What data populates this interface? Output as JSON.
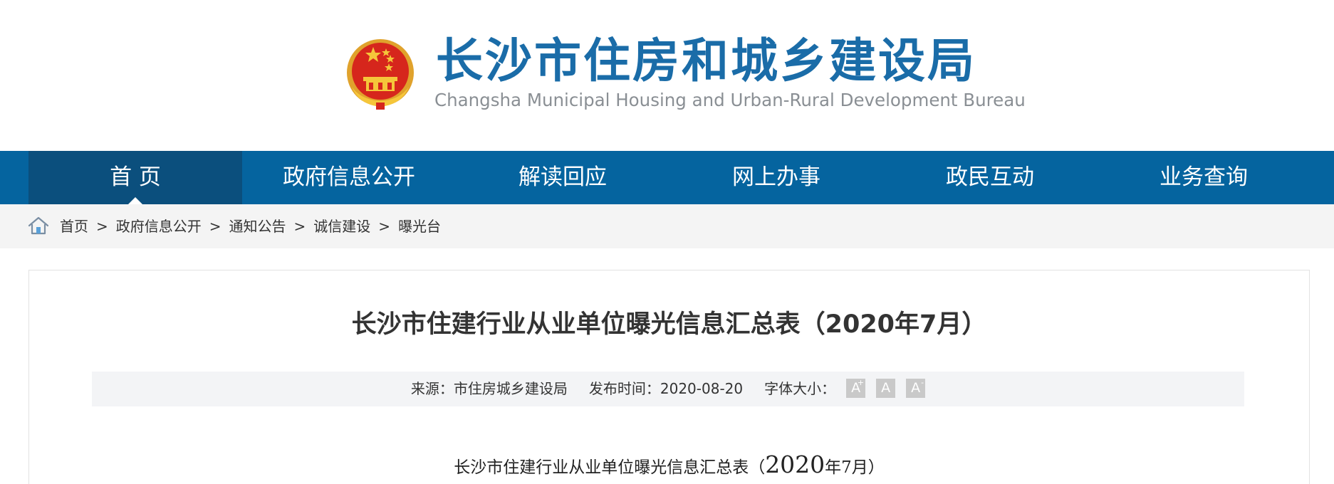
{
  "header": {
    "title_cn": "长沙市住房和城乡建设局",
    "title_en": "Changsha Municipal Housing and Urban-Rural Development Bureau",
    "emblem_icon": "national-emblem-icon"
  },
  "nav": {
    "items": [
      {
        "label": "首 页",
        "active": true
      },
      {
        "label": "政府信息公开",
        "active": false
      },
      {
        "label": "解读回应",
        "active": false
      },
      {
        "label": "网上办事",
        "active": false
      },
      {
        "label": "政民互动",
        "active": false
      },
      {
        "label": "业务查询",
        "active": false
      }
    ],
    "bg_color": "#05649f",
    "active_color": "#0b4f7d"
  },
  "breadcrumb": {
    "home_icon": "home-icon",
    "items": [
      "首页",
      "政府信息公开",
      "通知公告",
      "诚信建设",
      "曝光台"
    ],
    "separator": ">"
  },
  "article": {
    "title": "长沙市住建行业从业单位曝光信息汇总表（2020年7月）",
    "source_label": "来源：",
    "source": "市住房城乡建设局",
    "date_label": "发布时间：",
    "date": "2020-08-20",
    "font_size_label": "字体大小：",
    "font_buttons": [
      {
        "label": "A",
        "sup": "+"
      },
      {
        "label": "A",
        "sup": ""
      },
      {
        "label": "A",
        "sup": "-"
      }
    ],
    "body_title_pre": "长沙市住建行业从业单位曝光信息汇总表（",
    "body_title_year": "2020",
    "body_title_post": "年7月）"
  }
}
